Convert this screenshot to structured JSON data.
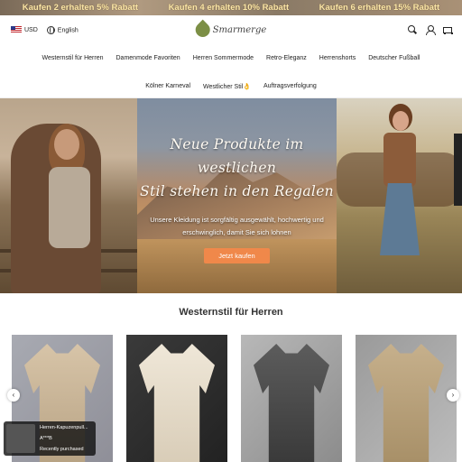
{
  "promo": [
    "Kaufen 2 erhalten 5% Rabatt",
    "Kaufen 4 erhalten 10% Rabatt",
    "Kaufen 6 erhalten 15% Rabatt"
  ],
  "header": {
    "currency": "USD",
    "language": "English",
    "logo_text": "Smarmerge"
  },
  "nav": {
    "row1": [
      "Westernstil für Herren",
      "Damenmode Favoriten",
      "Herren Sommermode",
      "Retro-Eleganz",
      "Herrenshorts",
      "Deutscher Fußball"
    ],
    "row2": [
      "Kölner Karneval",
      "Westlicher Stil👌",
      "Auftragsverfolgung"
    ]
  },
  "hero": {
    "headline_1": "Neue Produkte im westlichen",
    "headline_2": "Stil stehen in den Regalen",
    "subtext": "Unsere Kleidung ist sorgfältig ausgewählt, hochwertig und erschwinglich, damit Sie sich lohnen",
    "cta": "Jetzt kaufen"
  },
  "section": {
    "title": "Westernstil für Herren"
  },
  "toast": {
    "product": "Herren-Kapuzenpull...",
    "detail": "A***B",
    "status": "Recently purchased"
  },
  "colors": {
    "accent": "#f0884a",
    "promo_text": "#fbe7a8"
  }
}
